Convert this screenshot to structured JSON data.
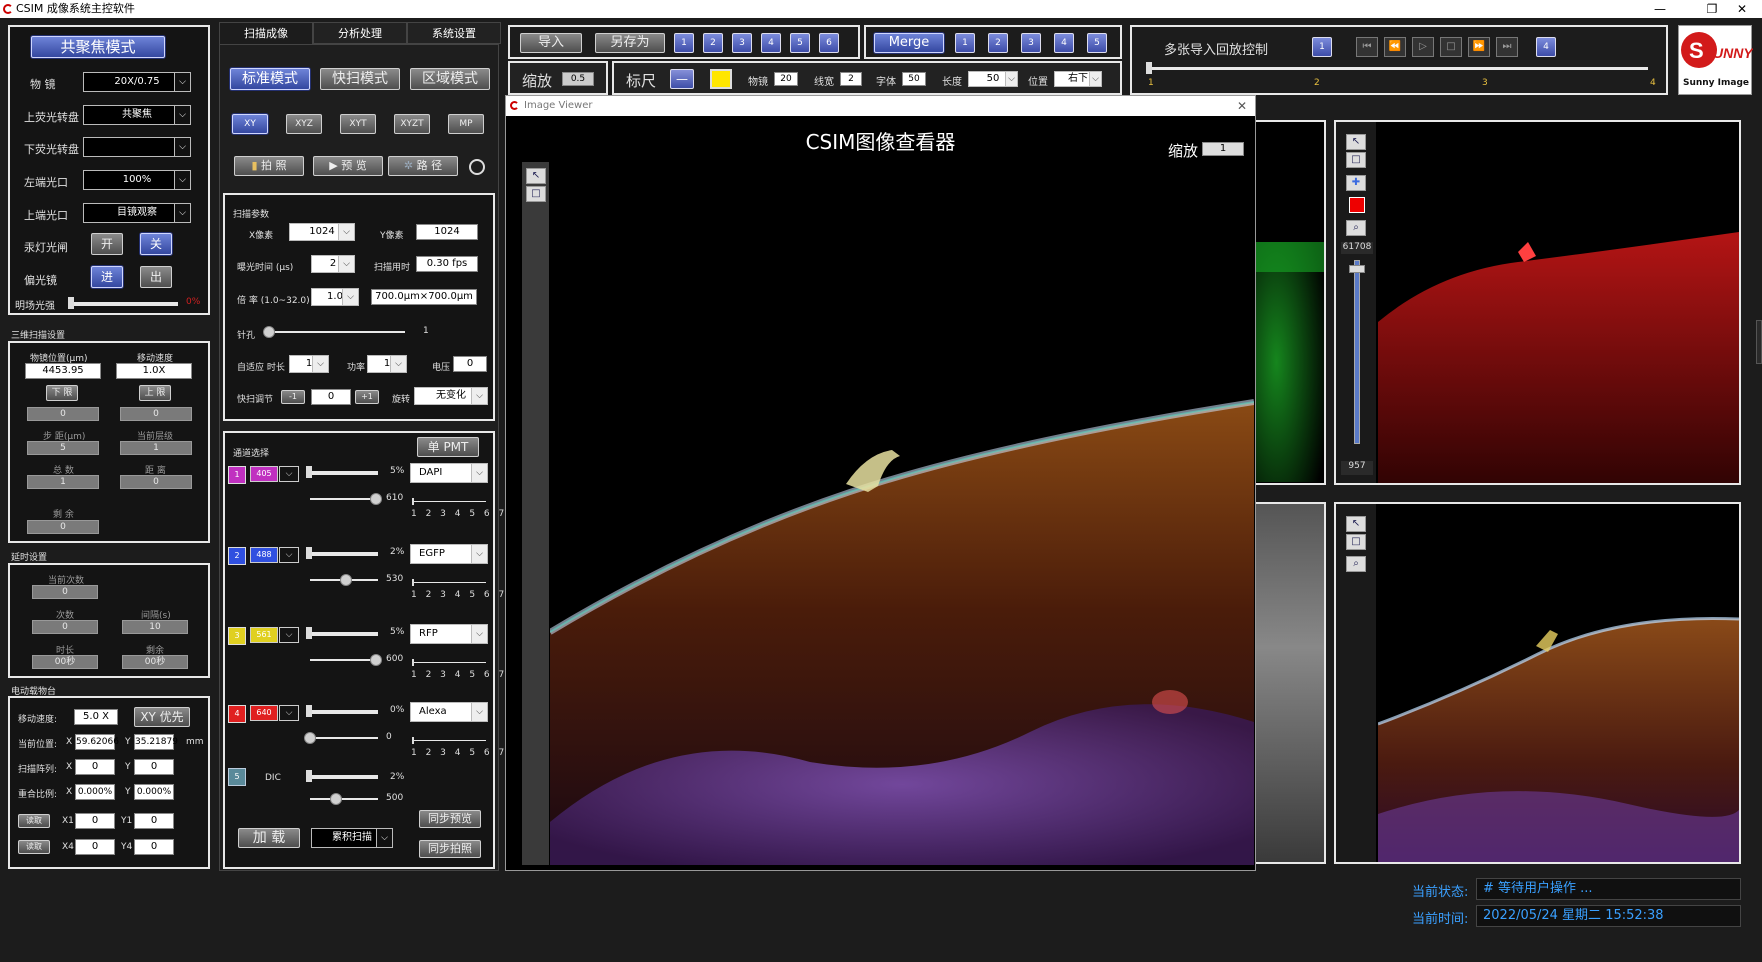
{
  "window": {
    "title": "CSIM 成像系统主控软件"
  },
  "left": {
    "confocal_button": "共聚焦模式",
    "objective_label": "物 镜",
    "objective_value": "20X/0.75",
    "upper_fl_label": "上荧光转盘",
    "upper_fl_value": "共聚焦",
    "lower_fl_label": "下荧光转盘",
    "lower_fl_value": "",
    "left_port_label": "左端光口",
    "left_port_value": "100%",
    "top_port_label": "上端光口",
    "top_port_value": "目镜观察",
    "mercury_label": "汞灯光闸",
    "mercury_on": "开",
    "mercury_off": "关",
    "polarizer_label": "偏光镜",
    "polarizer_in": "进",
    "polarizer_out": "出",
    "brightfield_label": "明场光强",
    "brightfield_value": "0%",
    "scan3d_title": "三维扫描设置",
    "obj_pos_label": "物镜位置(μm)",
    "obj_pos_value": "4453.95",
    "move_speed_label": "移动速度",
    "move_speed_value": "1.0X",
    "lower_limit": "下 限",
    "upper_limit": "上 限",
    "lower_value": "0",
    "upper_value": "0",
    "step_label": "步 距(μm)",
    "step_value": "5",
    "cur_layer_label": "当前层级",
    "cur_layer_value": "1",
    "total_label": "总 数",
    "total_value": "1",
    "distance_label": "距 离",
    "distance_value": "0",
    "remaining_label": "剩 余",
    "remaining_value": "0",
    "delay_title": "延时设置",
    "cur_count_label": "当前次数",
    "cur_count_value": "0",
    "count_label": "次数",
    "count_value": "0",
    "interval_label": "间隔(s)",
    "interval_value": "10",
    "duration_label": "时长",
    "duration_value": "00秒",
    "rest_label": "剩余",
    "rest_value": "00秒",
    "stage_title": "电动载物台",
    "stage_speed_label": "移动速度:",
    "stage_speed_value": "5.0 X",
    "xy_priority": "XY 优先",
    "cur_pos_label": "当前位置:",
    "x_label": "X",
    "y_label": "Y",
    "cur_x": "59.62066",
    "cur_y": "35.21879",
    "unit": "mm",
    "scan_array_label": "扫描阵列:",
    "scan_x": "0",
    "scan_y": "0",
    "overlap_label": "重合比例:",
    "overlap_x": "0.000%",
    "overlap_y": "0.000%",
    "read1": "读取",
    "read2": "读取",
    "x1_label": "X1",
    "x1": "0",
    "y1_label": "Y1",
    "y1": "0",
    "x4_label": "X4",
    "x4": "0",
    "y4_label": "Y4",
    "y4": "0"
  },
  "middle": {
    "tabs": [
      "扫描成像",
      "分析处理",
      "系统设置"
    ],
    "mode_buttons": [
      "标准模式",
      "快扫模式",
      "区域模式"
    ],
    "scan_types": [
      "XY",
      "XYZ",
      "XYT",
      "XYZT",
      "MP"
    ],
    "action_buttons": [
      "拍 照",
      "预 览",
      "路 径"
    ],
    "params_title": "扫描参数",
    "x_pixel_label": "X像素",
    "x_pixel": "1024",
    "y_pixel_label": "Y像素",
    "y_pixel": "1024",
    "exposure_label": "曝光时间 (μs)",
    "exposure_value": "2",
    "scan_time_label": "扫描用时",
    "scan_time": "0.30 fps",
    "zoom_label": "倍 率 (1.0~32.0)",
    "zoom_value": "1.0",
    "fov": "700.0μm×700.0μm",
    "pinhole_label": "针孔",
    "pinhole_value": "1",
    "adaptive_label": "自适应 时长",
    "adaptive_value": "1",
    "power_label": "功率",
    "power_value": "1",
    "voltage_label": "电压",
    "voltage_value": "0",
    "fast_adjust_label": "快扫调节",
    "minus": "-1",
    "fast_value": "0",
    "plus": "+1",
    "rotate_label": "旋转",
    "rotate_value": "无变化",
    "channel_title": "通道选择",
    "single_pmt": "单 PMT",
    "channels": [
      {
        "num": "1",
        "wavelength": "405",
        "percent": "5%",
        "dye": "DAPI",
        "gain": "610",
        "color": "#c030c0"
      },
      {
        "num": "2",
        "wavelength": "488",
        "percent": "2%",
        "dye": "EGFP",
        "gain": "530",
        "color": "#3050e0"
      },
      {
        "num": "3",
        "wavelength": "561",
        "percent": "5%",
        "dye": "RFP",
        "gain": "600",
        "color": "#e0d020"
      },
      {
        "num": "4",
        "wavelength": "640",
        "percent": "0%",
        "dye": "Alexa",
        "gain": "0",
        "color": "#e02020"
      }
    ],
    "dic_label": "DIC",
    "dic_percent": "2%",
    "dic_gain": "500",
    "ticks": "1 2 3 4 5 6 7 8",
    "load_button": "加 载",
    "accumulate": "累积扫描",
    "sync_preview": "同步预览",
    "sync_photo": "同步拍照"
  },
  "top": {
    "import": "导入",
    "save_as": "另存为",
    "num_buttons": [
      "1",
      "2",
      "3",
      "4",
      "5",
      "6"
    ],
    "merge": "Merge",
    "merge_buttons": [
      "1",
      "2",
      "3",
      "4",
      "5"
    ],
    "zoom_label": "缩放",
    "zoom_value": "0.5",
    "ruler_label": "标尺",
    "ruler_minus": "—",
    "obj_label": "物镜",
    "obj_value": "20",
    "line_label": "线宽",
    "line_value": "2",
    "font_label": "字体",
    "font_value": "50",
    "length_label": "长度",
    "length_value": "50",
    "pos_label": "位置",
    "pos_value": "右下",
    "playback_label": "多张导入回放控制",
    "playback_left": "1",
    "playback_right": "4",
    "timeline": [
      "1",
      "2",
      "3",
      "4"
    ],
    "brand": "Sunny Image"
  },
  "viewer": {
    "title": "Image Viewer",
    "heading": "CSIM图像查看器",
    "zoom_label": "缩放",
    "zoom_value": "1"
  },
  "right_panels": {
    "slider_max": "61708",
    "slider_min": "957"
  },
  "status": {
    "state_label": "当前状态:",
    "state_value": "# 等待用户操作 ...",
    "time_label": "当前时间:",
    "time_value": "2022/05/24  星期二  15:52:38"
  }
}
